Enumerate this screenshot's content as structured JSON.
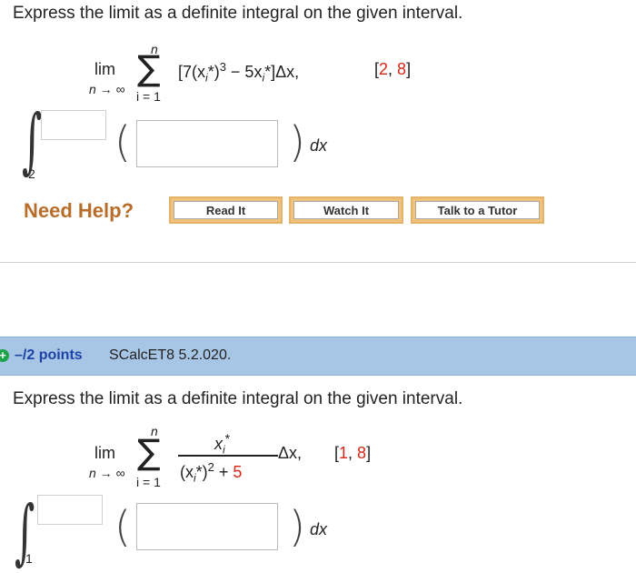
{
  "q1": {
    "prompt": "Express the limit as a definite integral on the given interval.",
    "lim": "lim",
    "lim_sub": "n → ∞",
    "sum_top": "n",
    "sum_bottom": "i = 1",
    "expr_a": "[7(x",
    "expr_sub_i_1": "i",
    "expr_b": "*)",
    "expr_sup": "3",
    "expr_c": " − 5x",
    "expr_sub_i_2": "i",
    "expr_d": "*]Δx,",
    "interval_open": "[",
    "interval_a": "2",
    "interval_comma": ", ",
    "interval_b": "8",
    "interval_close": "]",
    "lower_limit": "2",
    "dx": "dx"
  },
  "help": {
    "label": "Need Help?",
    "read": "Read It",
    "watch": "Watch It",
    "tutor": "Talk to a Tutor"
  },
  "q2_header": {
    "points": "–/2 points",
    "id": "SCalcET8 5.2.020."
  },
  "q2": {
    "prompt": "Express the limit as a definite integral on the given interval.",
    "lim": "lim",
    "lim_sub": "n → ∞",
    "sum_top": "n",
    "sum_bottom": "i = 1",
    "num_x": "x",
    "num_sub": "i",
    "num_star": "*",
    "den_a": "(x",
    "den_sub": "i",
    "den_b": "*)",
    "den_sup": "2",
    "den_c": " + ",
    "den_d": "5",
    "dx_after": "Δx,",
    "interval_open": "[",
    "interval_a": "1",
    "interval_comma": ", ",
    "interval_b": "8",
    "interval_close": "]",
    "lower_limit": "1",
    "dx": "dx"
  }
}
